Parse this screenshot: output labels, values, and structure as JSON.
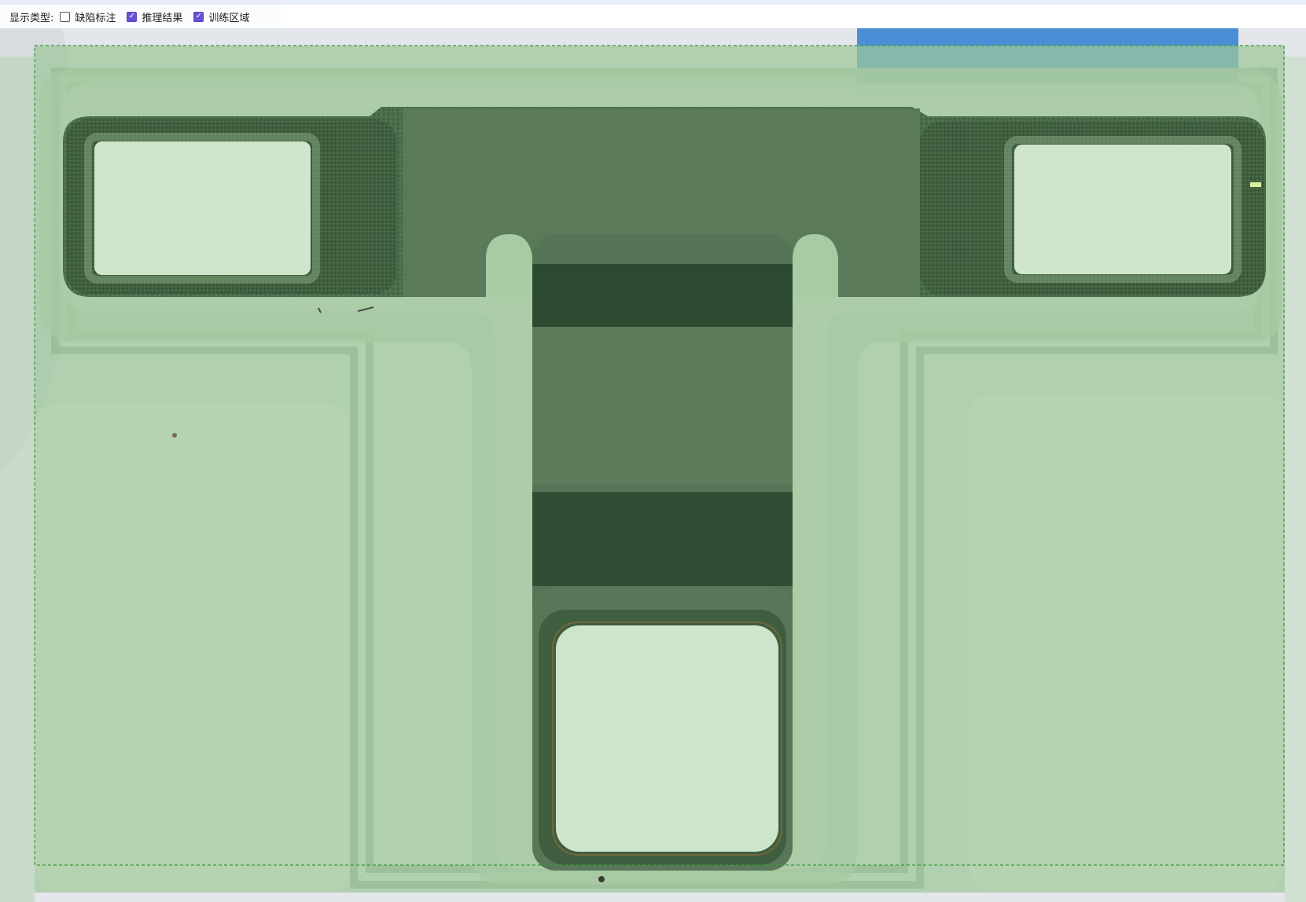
{
  "toolbar": {
    "display_type_label": "显示类型:",
    "options": [
      {
        "label": "缺陷标注",
        "checked": false
      },
      {
        "label": "推理结果",
        "checked": true
      },
      {
        "label": "训练区域",
        "checked": true
      }
    ]
  },
  "icons": {
    "checkbox_checked": "checkmark-icon"
  },
  "colors": {
    "accent": "#6a4fd4",
    "overlay_green": "#9ec89a",
    "pad_light": "#cbe5c9",
    "roi_border": "#3a9a3a",
    "blue_label": "#4a8fd6"
  }
}
